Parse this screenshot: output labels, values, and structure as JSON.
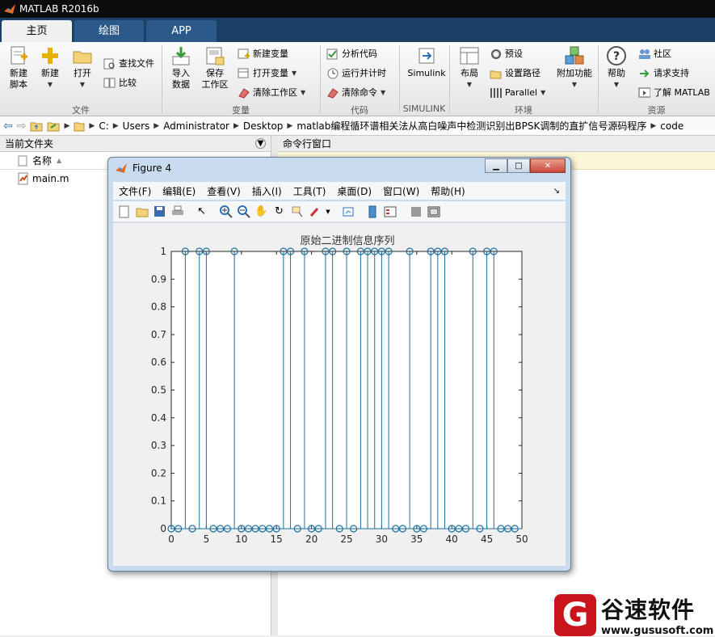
{
  "app": {
    "title": "MATLAB R2016b"
  },
  "tabs": [
    {
      "label": "主页"
    },
    {
      "label": "绘图"
    },
    {
      "label": "APP"
    }
  ],
  "ribbon": {
    "file": {
      "new_script": "新建\n脚本",
      "new": "新建",
      "open": "打开",
      "find_files": "查找文件",
      "compare": "比较",
      "group": "文件"
    },
    "variable": {
      "import": "导入\n数据",
      "save_ws": "保存\n工作区",
      "new_var": "新建变量",
      "open_var": "打开变量",
      "clear_ws": "清除工作区",
      "group": "变量"
    },
    "code": {
      "analyze": "分析代码",
      "run_time": "运行并计时",
      "clear_cmd": "清除命令",
      "group": "代码"
    },
    "simulink": {
      "label": "Simulink",
      "group": "SIMULINK"
    },
    "env": {
      "layout": "布局",
      "prefs": "预设",
      "set_path": "设置路径",
      "parallel": "Parallel",
      "addons": "附加功能",
      "group": "环境"
    },
    "resources": {
      "help": "帮助",
      "community": "社区",
      "support": "请求支持",
      "learn": "了解 MATLAB",
      "group": "资源"
    }
  },
  "address": {
    "parts": [
      "C:",
      "Users",
      "Administrator",
      "Desktop",
      "matlab编程循环谱相关法从高白噪声中检测识别出BPSK调制的直扩信号源码程序",
      "code"
    ]
  },
  "current_folder": {
    "title": "当前文件夹",
    "column": "名称",
    "files": [
      "main.m"
    ]
  },
  "command_window": {
    "title": "命令行窗口"
  },
  "figure": {
    "title": "Figure 4",
    "menu": [
      "文件(F)",
      "编辑(E)",
      "查看(V)",
      "插入(I)",
      "工具(T)",
      "桌面(D)",
      "窗口(W)",
      "帮助(H)"
    ]
  },
  "chart_data": {
    "type": "stem",
    "title": "原始二进制信息序列",
    "xlabel": "",
    "ylabel": "",
    "xlim": [
      0,
      50
    ],
    "ylim": [
      0,
      1
    ],
    "xticks": [
      0,
      5,
      10,
      15,
      20,
      25,
      30,
      35,
      40,
      45,
      50
    ],
    "yticks": [
      0,
      0.1,
      0.2,
      0.3,
      0.4,
      0.5,
      0.6,
      0.7,
      0.8,
      0.9,
      1
    ],
    "x": [
      0,
      1,
      2,
      3,
      4,
      5,
      6,
      7,
      8,
      9,
      10,
      11,
      12,
      13,
      14,
      15,
      16,
      17,
      18,
      19,
      20,
      21,
      22,
      23,
      24,
      25,
      26,
      27,
      28,
      29,
      30,
      31,
      32,
      33,
      34,
      35,
      36,
      37,
      38,
      39,
      40,
      41,
      42,
      43,
      44,
      45,
      46,
      47,
      48,
      49
    ],
    "values": [
      0,
      0,
      1,
      0,
      1,
      1,
      0,
      0,
      0,
      1,
      0,
      0,
      0,
      0,
      0,
      0,
      1,
      1,
      0,
      1,
      0,
      0,
      1,
      1,
      0,
      1,
      0,
      1,
      1,
      1,
      1,
      1,
      0,
      0,
      1,
      0,
      0,
      1,
      1,
      1,
      0,
      0,
      0,
      1,
      0,
      1,
      1,
      0,
      0,
      0
    ],
    "color": "#1b6f9e"
  },
  "watermark": {
    "logo": "G",
    "name": "谷速软件",
    "url": "www.gususoft.com"
  }
}
